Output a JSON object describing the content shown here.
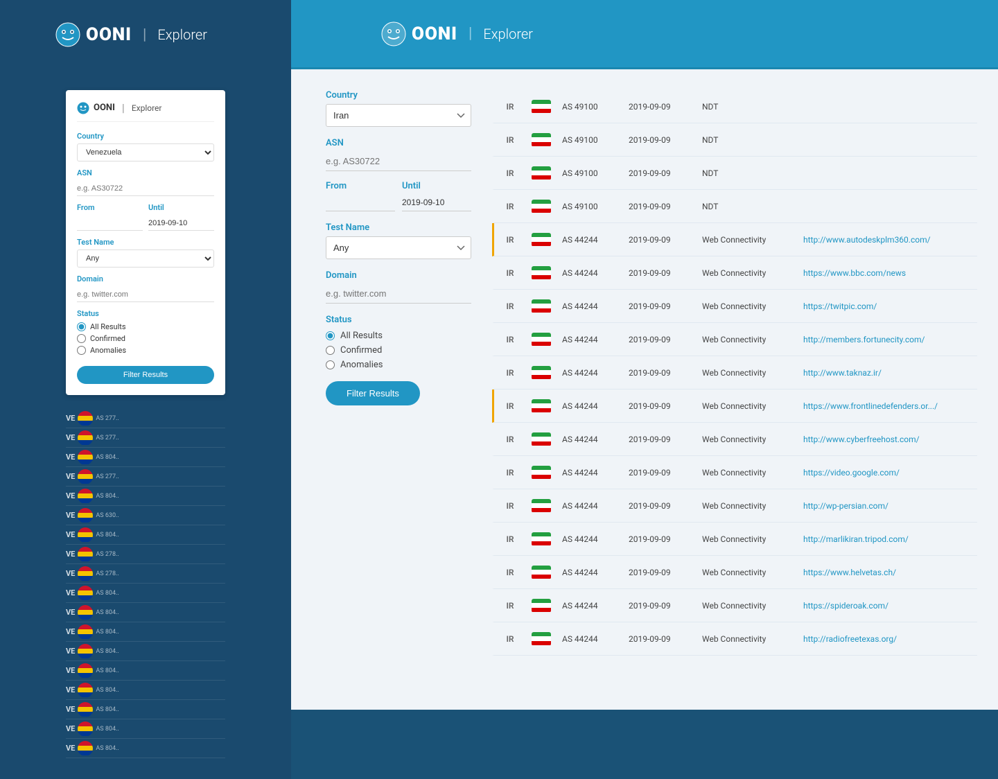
{
  "app": {
    "logo_icon": "🔮",
    "logo_ooni": "OONI",
    "logo_sep": "|",
    "logo_explorer": "Explorer"
  },
  "sidebar_filter": {
    "country_label": "Country",
    "country_value": "Venezuela",
    "asn_label": "ASN",
    "asn_placeholder": "e.g. AS30722",
    "from_label": "From",
    "until_label": "Until",
    "until_value": "2019-09-10",
    "test_name_label": "Test Name",
    "test_name_value": "Any",
    "domain_label": "Domain",
    "domain_placeholder": "e.g. twitter.com",
    "status_label": "Status",
    "status_options": [
      "All Results",
      "Confirmed",
      "Anomalies"
    ],
    "status_selected": "All Results",
    "filter_btn": "Filter Results"
  },
  "main_filter": {
    "country_label": "Country",
    "country_value": "Iran",
    "asn_label": "ASN",
    "asn_placeholder": "e.g. AS30722",
    "from_label": "From",
    "until_label": "Until",
    "until_value": "2019-09-10",
    "test_name_label": "Test Name",
    "test_name_value": "Any",
    "domain_label": "Domain",
    "domain_placeholder": "e.g. twitter.com",
    "status_label": "Status",
    "status_options": [
      "All Results",
      "Confirmed",
      "Anomalies"
    ],
    "status_selected": "All Results",
    "filter_btn": "Filter Results"
  },
  "results": [
    {
      "cc": "IR",
      "asn": "AS 49100",
      "date": "2019-09-09",
      "test": "NDT",
      "url": "",
      "anomaly": false
    },
    {
      "cc": "IR",
      "asn": "AS 49100",
      "date": "2019-09-09",
      "test": "NDT",
      "url": "",
      "anomaly": false
    },
    {
      "cc": "IR",
      "asn": "AS 49100",
      "date": "2019-09-09",
      "test": "NDT",
      "url": "",
      "anomaly": false
    },
    {
      "cc": "IR",
      "asn": "AS 49100",
      "date": "2019-09-09",
      "test": "NDT",
      "url": "",
      "anomaly": false
    },
    {
      "cc": "IR",
      "asn": "AS 44244",
      "date": "2019-09-09",
      "test": "Web Connectivity",
      "url": "http://www.autodeskplm360.com/",
      "anomaly": true
    },
    {
      "cc": "IR",
      "asn": "AS 44244",
      "date": "2019-09-09",
      "test": "Web Connectivity",
      "url": "https://www.bbc.com/news",
      "anomaly": false
    },
    {
      "cc": "IR",
      "asn": "AS 44244",
      "date": "2019-09-09",
      "test": "Web Connectivity",
      "url": "https://twitpic.com/",
      "anomaly": false
    },
    {
      "cc": "IR",
      "asn": "AS 44244",
      "date": "2019-09-09",
      "test": "Web Connectivity",
      "url": "http://members.fortunecity.com/",
      "anomaly": false
    },
    {
      "cc": "IR",
      "asn": "AS 44244",
      "date": "2019-09-09",
      "test": "Web Connectivity",
      "url": "http://www.taknaz.ir/",
      "anomaly": false
    },
    {
      "cc": "IR",
      "asn": "AS 44244",
      "date": "2019-09-09",
      "test": "Web Connectivity",
      "url": "https://www.frontlinedefenders.or.../",
      "anomaly": true
    },
    {
      "cc": "IR",
      "asn": "AS 44244",
      "date": "2019-09-09",
      "test": "Web Connectivity",
      "url": "http://www.cyberfreehost.com/",
      "anomaly": false
    },
    {
      "cc": "IR",
      "asn": "AS 44244",
      "date": "2019-09-09",
      "test": "Web Connectivity",
      "url": "https://video.google.com/",
      "anomaly": false
    },
    {
      "cc": "IR",
      "asn": "AS 44244",
      "date": "2019-09-09",
      "test": "Web Connectivity",
      "url": "http://wp-persian.com/",
      "anomaly": false
    },
    {
      "cc": "IR",
      "asn": "AS 44244",
      "date": "2019-09-09",
      "test": "Web Connectivity",
      "url": "http://marlikiran.tripod.com/",
      "anomaly": false
    },
    {
      "cc": "IR",
      "asn": "AS 44244",
      "date": "2019-09-09",
      "test": "Web Connectivity",
      "url": "https://www.helvetas.ch/",
      "anomaly": false
    },
    {
      "cc": "IR",
      "asn": "AS 44244",
      "date": "2019-09-09",
      "test": "Web Connectivity",
      "url": "https://spideroak.com/",
      "anomaly": false
    },
    {
      "cc": "IR",
      "asn": "AS 44244",
      "date": "2019-09-09",
      "test": "Web Connectivity",
      "url": "http://radiofreetexas.org/",
      "anomaly": false
    }
  ],
  "sidebar_mini_rows": [
    {
      "cc": "VE",
      "asn": "AS 277.."
    },
    {
      "cc": "VE",
      "asn": "AS 277.."
    },
    {
      "cc": "VE",
      "asn": "AS 804.."
    },
    {
      "cc": "VE",
      "asn": "AS 277.."
    },
    {
      "cc": "VE",
      "asn": "AS 804.."
    },
    {
      "cc": "VE",
      "asn": "AS 630.."
    },
    {
      "cc": "VE",
      "asn": "AS 804.."
    },
    {
      "cc": "VE",
      "asn": "AS 278.."
    },
    {
      "cc": "VE",
      "asn": "AS 278.."
    },
    {
      "cc": "VE",
      "asn": "AS 804.."
    },
    {
      "cc": "VE",
      "asn": "AS 804.."
    },
    {
      "cc": "VE",
      "asn": "AS 804.."
    },
    {
      "cc": "VE",
      "asn": "AS 804.."
    },
    {
      "cc": "VE",
      "asn": "AS 804.."
    },
    {
      "cc": "VE",
      "asn": "AS 804.."
    },
    {
      "cc": "VE",
      "asn": "AS 804.."
    },
    {
      "cc": "VE",
      "asn": "AS 804.."
    },
    {
      "cc": "VE",
      "asn": "AS 804.."
    }
  ]
}
